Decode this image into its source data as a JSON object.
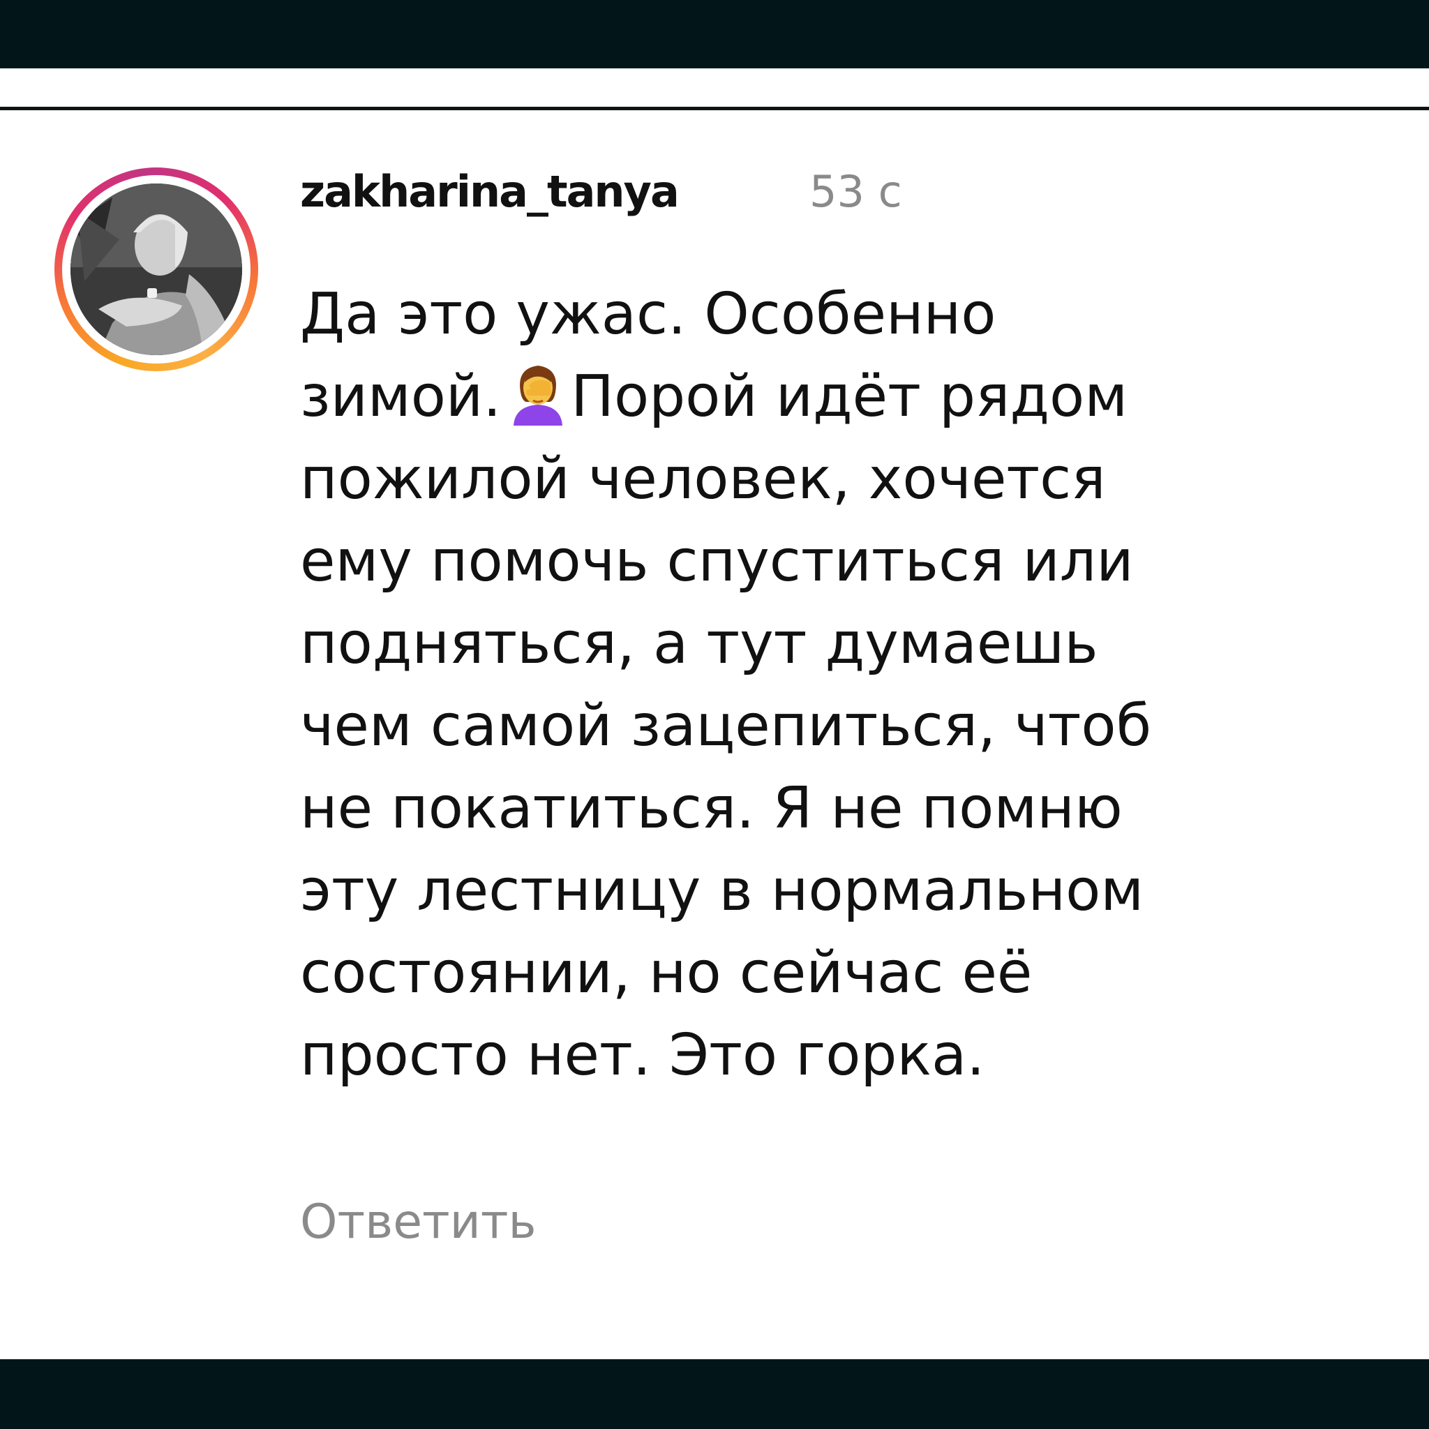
{
  "comment": {
    "username": "zakharina_tanya",
    "timestamp": "53 с",
    "lines": [
      "Да это ужас. Особенно",
      "зимой.",
      "Порой идёт рядом",
      "пожилой человек, хочется",
      "ему помочь спуститься или",
      "подняться, а тут думаешь",
      "чем самой зацепиться, чтоб",
      "не покатиться. Я не помню",
      "эту лестницу в нормальном",
      "состоянии, но сейчас её",
      "просто нет. Это горка."
    ],
    "emoji": "woman-facepalming-icon",
    "reply_label": "Ответить"
  },
  "colors": {
    "bar": "#02161a",
    "username": "#111111",
    "secondary_text": "#8a8a8a",
    "story_ring": [
      "#f9a825",
      "#e1306c",
      "#c13584"
    ]
  }
}
